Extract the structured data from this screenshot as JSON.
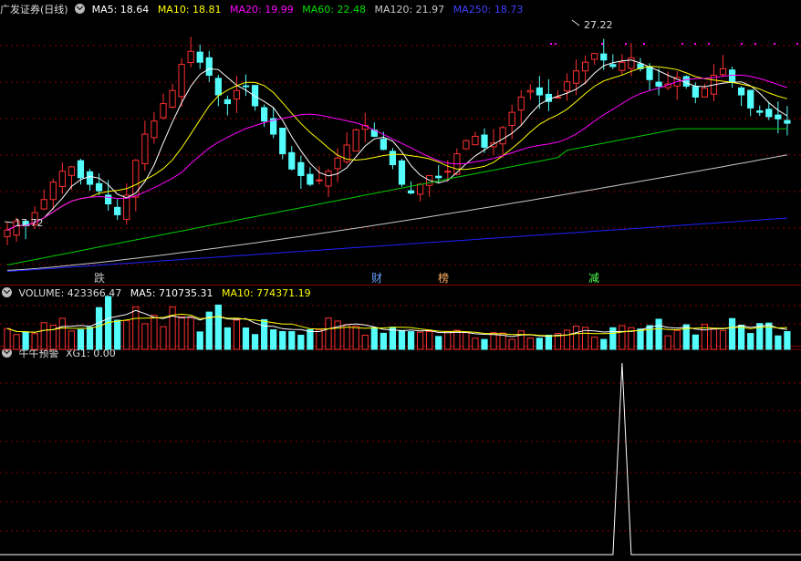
{
  "main_panel": {
    "title": "广发证券(日线)",
    "ma5": "MA5: 18.64",
    "ma10": "MA10: 18.81",
    "ma20": "MA20: 19.99",
    "ma60": "MA60: 22.48",
    "ma120": "MA120: 21.97",
    "ma250": "MA250: 18.73",
    "high_label": "27.22",
    "low_label": "17.72",
    "markers": [
      "跌",
      "财",
      "榜",
      "减"
    ]
  },
  "volume_panel": {
    "volume": "VOLUME: 423366.47",
    "ma5": "MA5: 710735.31",
    "ma10": "MA10: 774371.19"
  },
  "indicator_panel": {
    "name": "牛牛预警",
    "xg1": "XG1: 0.00"
  },
  "colors": {
    "up": "#ff3030",
    "down": "#54fcfc",
    "ma5": "#ffffff",
    "ma10": "#ffff00",
    "ma20": "#ff00ff",
    "ma60": "#00cc00",
    "ma120": "#c8c8c8",
    "ma250": "#2020ff",
    "grid": "#8a0000"
  },
  "chart_data": {
    "type": "candlestick",
    "price_range": [
      17.72,
      27.22
    ],
    "closes": [
      18.2,
      18.6,
      18.4,
      19.0,
      19.6,
      20.4,
      20.9,
      21.1,
      20.6,
      20.3,
      20.0,
      19.4,
      18.9,
      19.8,
      21.4,
      22.6,
      23.2,
      24.0,
      24.6,
      25.8,
      26.4,
      25.9,
      25.3,
      24.4,
      24.0,
      24.6,
      24.8,
      23.9,
      23.2,
      22.6,
      21.7,
      21.0,
      20.7,
      20.3,
      20.5,
      20.9,
      21.5,
      22.1,
      22.8,
      23.0,
      22.5,
      21.9,
      21.2,
      20.3,
      19.9,
      20.3,
      20.7,
      20.6,
      20.9,
      21.7,
      22.3,
      22.5,
      22.0,
      22.2,
      22.9,
      23.6,
      24.3,
      24.6,
      24.4,
      24.1,
      24.3,
      25.0,
      25.5,
      25.9,
      26.3,
      26.0,
      25.7,
      25.9,
      26.1,
      25.6,
      25.1,
      24.8,
      24.9,
      25.2,
      24.8,
      24.3,
      24.7,
      25.3,
      25.6,
      25.0,
      24.4,
      23.8,
      23.6,
      23.4,
      23.3,
      23.1
    ],
    "volume_range": [
      0,
      1500000
    ],
    "signal": {
      "xg1_peak_index": 67,
      "xg1_peak_value": 1,
      "xg1_current": 0
    }
  }
}
